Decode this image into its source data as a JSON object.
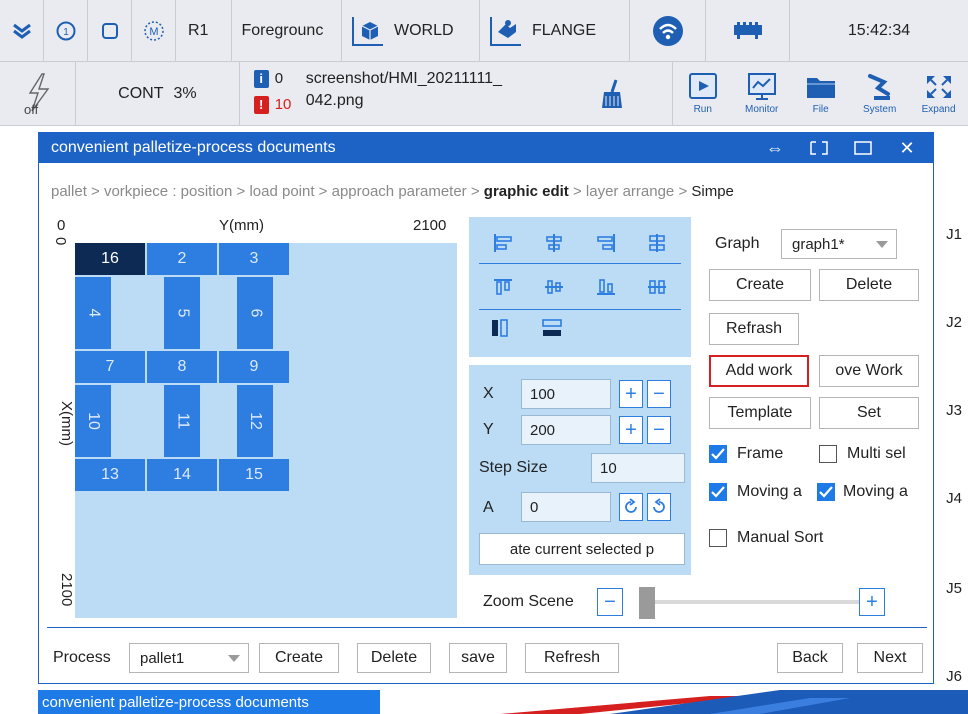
{
  "topbar": {
    "robot": "R1",
    "mode": "Foregrounc",
    "coord_frame": "WORLD",
    "tool_frame": "FLANGE",
    "time": "15:42:34"
  },
  "toolbar": {
    "servo_state": "off",
    "run_mode": "CONT",
    "speed": "3%",
    "info_count": "0",
    "error_count": "10",
    "message_line1": "screenshot/HMI_20211111_",
    "message_line2": "042.png",
    "buttons": {
      "run": "Run",
      "monitor": "Monitor",
      "file": "File",
      "system": "System",
      "expand": "Expand"
    }
  },
  "dialog": {
    "title": "convenient palletize-process documents",
    "breadcrumb": {
      "prefix": "pallet > vorkpiece : position > load point > approach parameter > ",
      "current": "graphic edit",
      "mid": " > layer arrange >  ",
      "last": "Simpe"
    }
  },
  "canvas": {
    "x_axis_start": "0",
    "x_axis_label": "Y(mm)",
    "x_axis_end": "2100",
    "y_axis_start": "0",
    "y_axis_label": "X(mm)",
    "y_axis_end": "2100",
    "cells": [
      "16",
      "2",
      "3",
      "4",
      "5",
      "6",
      "7",
      "8",
      "9",
      "10",
      "11",
      "12",
      "13",
      "14",
      "15"
    ]
  },
  "coords": {
    "x_label": "X",
    "x_value": "100",
    "y_label": "Y",
    "y_value": "200",
    "step_label": "Step Size",
    "step_value": "10",
    "a_label": "A",
    "a_value": "0",
    "update_label": "ate current selected p"
  },
  "zoom": {
    "label": "Zoom Scene",
    "minus": "−",
    "plus": "+"
  },
  "right_panel": {
    "graph_label": "Graph",
    "graph_value": "graph1*",
    "create": "Create",
    "delete": "Delete",
    "refresh": "Refrash",
    "add_work": "Add work",
    "remove_work": "ove Work",
    "template": "Template",
    "set": "Set",
    "frame": "Frame",
    "multi_sel": "Multi sel",
    "moving_a": "Moving a",
    "moving_b": "Moving a",
    "manual_sort": "Manual Sort"
  },
  "bottom": {
    "process_label": "Process",
    "process_value": "pallet1",
    "create": "Create",
    "delete": "Delete",
    "save": "save",
    "refresh": "Refresh",
    "back": "Back",
    "next": "Next"
  },
  "joints": [
    "J1",
    "J2",
    "J3",
    "J4",
    "J5",
    "J6"
  ],
  "taskbar": {
    "item": "convenient palletize-process documents"
  },
  "colors": {
    "accent": "#1d63c6",
    "cell": "#2e7de0",
    "selected_cell": "#0d2a55",
    "canvas_bg": "#bcdcf5",
    "highlight": "#d6201f"
  }
}
